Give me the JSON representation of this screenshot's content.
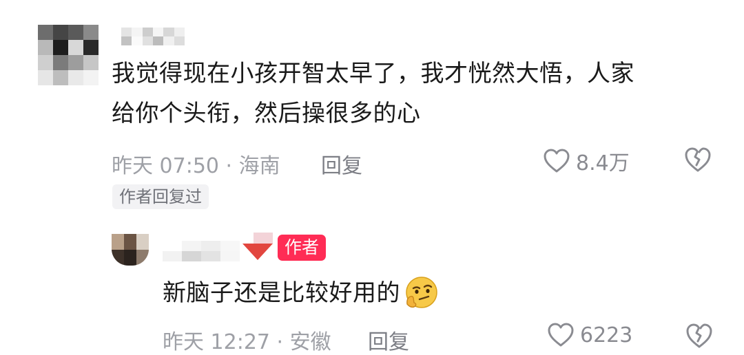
{
  "comment": {
    "text_line1": "我觉得现在小孩开智太早了，我才恍然大悟，人家",
    "text_line2": "给你个头衔，然后操很多的心",
    "meta": "昨天 07:50 · 海南",
    "reply_label": "回复",
    "likes": "8.4万",
    "author_replied_label": "作者回复过"
  },
  "reply": {
    "author_badge": "作者",
    "text": "新脑子还是比较好用的",
    "emoji_icon": "thinking-smirk-emoji",
    "meta": "昨天 12:27 · 安徽",
    "reply_label": "回复",
    "likes": "6223"
  },
  "icons": {
    "like": "heart-outline-icon",
    "dislike": "broken-heart-icon"
  },
  "colors": {
    "badge": "#ff2c55",
    "meta_text": "#9ea0a6",
    "body_text": "#1a1a1a"
  }
}
